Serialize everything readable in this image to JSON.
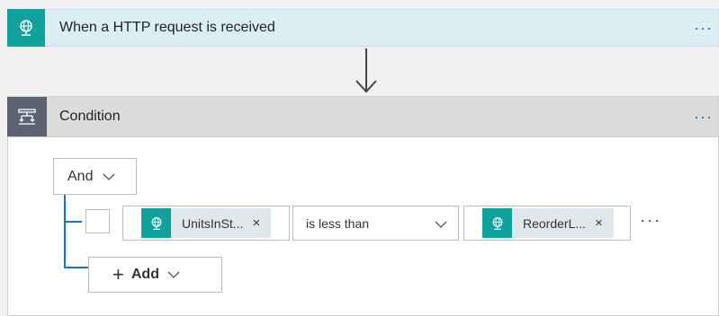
{
  "trigger": {
    "title": "When a HTTP request is received",
    "icon": "http-request-icon",
    "more_label": "···",
    "accent": "#13a19e"
  },
  "condition": {
    "title": "Condition",
    "icon": "condition-icon",
    "more_label": "···",
    "header_icon_color": "#5b6470",
    "group_operator": "And",
    "row": {
      "left_operand": "UnitsInSt...",
      "operator": "is less than",
      "right_operand": "ReorderL...",
      "close_label": "×",
      "more_label": "···"
    },
    "add_label": "Add",
    "plus_label": "+"
  }
}
